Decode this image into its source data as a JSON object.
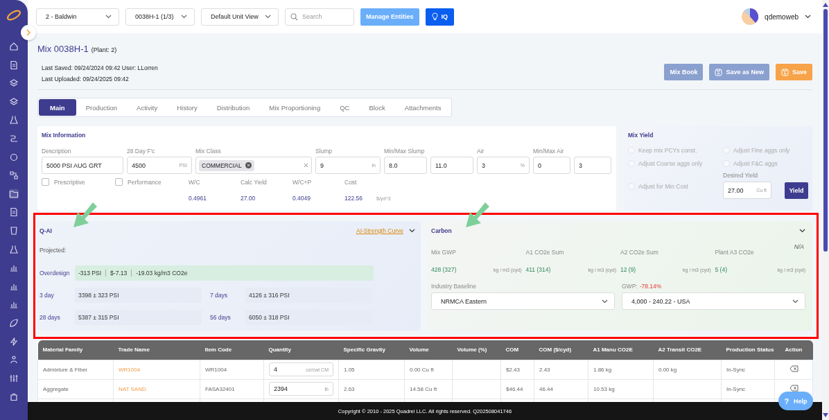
{
  "topbar": {
    "selects": [
      "2 - Baldwin",
      "0038H-1 (1/3)",
      "Default Unit View"
    ],
    "search": {
      "placeholder": "Search"
    },
    "manage_button": "Manage Entities",
    "iq_button": "IQ",
    "user": "qdemoweb"
  },
  "header": {
    "title": "Mix 0038H-1",
    "plant": "(Plant: 2)",
    "last_saved": "Last Saved: 09/24/2024 09:42 User: LLorren",
    "last_uploaded": "Last Uploaded: 09/24/2025 09:42",
    "buttons": [
      {
        "label": "Mix Book",
        "kind": "plain"
      },
      {
        "label": "Save as New",
        "kind": "secondary"
      },
      {
        "label": "Save",
        "kind": "primary"
      }
    ]
  },
  "tabs": [
    {
      "label": "Main",
      "selected": true
    },
    {
      "label": "Production",
      "selected": false
    },
    {
      "label": "Activity",
      "selected": false
    },
    {
      "label": "History",
      "selected": false
    },
    {
      "label": "Distribution",
      "selected": false
    },
    {
      "label": "Mix Proportioning",
      "selected": false
    },
    {
      "label": "QC",
      "selected": false
    },
    {
      "label": "Block",
      "selected": false
    },
    {
      "label": "Attachments",
      "selected": false
    }
  ],
  "mix_information": {
    "title": "Mix Information",
    "fields": [
      {
        "label": "Description",
        "kind": "text",
        "inputs": [
          {
            "value": "5000 PSI AUG GRT"
          }
        ]
      },
      {
        "label": "28 Day F'c",
        "kind": "text",
        "inputs": [
          {
            "value": "4500",
            "unit": "PSI"
          }
        ]
      },
      {
        "label": "Mix Class",
        "kind": "chips",
        "chips": [
          "COMMERCIAL"
        ]
      },
      {
        "label": "Slump",
        "kind": "text",
        "inputs": [
          {
            "value": "9",
            "unit": "in"
          }
        ]
      },
      {
        "label": "Min/Max Slump",
        "kind": "text",
        "inputs": [
          {
            "value": "8.0"
          },
          {
            "value": "11.0"
          }
        ]
      },
      {
        "label": "Air",
        "kind": "text",
        "inputs": [
          {
            "value": "3",
            "unit": "%"
          }
        ]
      },
      {
        "label": "Min/Max Air",
        "kind": "text",
        "inputs": [
          {
            "value": "0"
          },
          {
            "value": "3"
          }
        ]
      }
    ],
    "checkboxes": [
      {
        "label": "Prescriptive",
        "checked": false
      },
      {
        "label": "Performance",
        "checked": false
      }
    ],
    "stats": [
      {
        "label": "W/C",
        "value": "0.4961"
      },
      {
        "label": "Calc Yield",
        "value": "27.00"
      },
      {
        "label": "W/C+P",
        "value": "0.4049"
      },
      {
        "label": "Cost",
        "value": "122.56",
        "unit": "$/yd^3"
      }
    ]
  },
  "mix_yield": {
    "title": "Mix Yield",
    "options": [
      {
        "label": "Keep mix PCYs const.",
        "selected": false
      },
      {
        "label": "Adjust Fine aggs only",
        "selected": false
      },
      {
        "label": "Adjust Coarse aggs only",
        "selected": false
      },
      {
        "label": "Adjust F&C aggs",
        "selected": false
      },
      {
        "label": "Adjust for Min Cost",
        "selected": false
      }
    ],
    "desired_label": "Desired Yield",
    "desired_value": "27.00",
    "desired_unit": "Cu ft",
    "button": "Yield"
  },
  "q_ai": {
    "title": "Q-AI",
    "link": "AI-Strength Curve",
    "projected": "Projected:",
    "overdesign_label": "Overdesign",
    "overdesign": [
      "-313 PSI",
      "$-7.13",
      "-19.03 kg/m3 CO2e"
    ],
    "strengths": [
      {
        "label": "3 day",
        "value": "3398 ± 323 PSI"
      },
      {
        "label": "7 days",
        "value": "4126 ± 316 PSI"
      },
      {
        "label": "28 days",
        "value": "5387 ± 315 PSI"
      },
      {
        "label": "56 days",
        "value": "6050 ± 318 PSI"
      }
    ]
  },
  "carbon": {
    "title": "Carbon",
    "note": "N/A",
    "metrics": [
      {
        "label": "Mix GWP",
        "value": "428 (327)",
        "unit": "kg / m3 (cyd)"
      },
      {
        "label": "A1 CO2e Sum",
        "value": "411 (314)",
        "unit": "kg / m3 (cyd)"
      },
      {
        "label": "A2 CO2e Sum",
        "value": "12 (9)",
        "unit": "kg / m3 (cyd)"
      },
      {
        "label": "Plant A3 CO2e",
        "value": "5 (4)",
        "unit": "kg / m3 (cyd)"
      }
    ],
    "baseline_label": "Industry Baseline",
    "baseline": "NRMCA Eastern",
    "gwp_label": "GWP:",
    "gwp_value": "-78.14%",
    "gwp_select": "4,000 - 240.22 - USA"
  },
  "table": {
    "columns": [
      "Material Family",
      "Trade Name",
      "Item Code",
      "Quantity",
      "Specific Gravity",
      "Volume",
      "Volume (%)",
      "COM",
      "COM ($/cyd)",
      "A1 Manu CO2E",
      "A2 Transit CO2E",
      "Production Status",
      "Action"
    ],
    "rows": [
      {
        "family": "Admixture & Fiber",
        "trade_name": "WR1004",
        "item_code": "WR1004",
        "quantity": "4",
        "quantity_unit": "oz/cwt CM",
        "specific_gravity": "1.05",
        "volume": "0.00 Cu ft",
        "com": "$2.43",
        "com_cyd": "2.43",
        "a1": "1.86 kg",
        "a2": "0.00 kg",
        "status": "In-Sync"
      },
      {
        "family": "Aggregate",
        "trade_name": "NAT SAND",
        "item_code": "FASA32401",
        "quantity": "2394",
        "quantity_unit": "lb",
        "specific_gravity": "2.63",
        "volume": "14.58 Cu ft",
        "com": "$46.44",
        "com_cyd": "46.44",
        "a1": "10.53 kg",
        "status": "In-Sync"
      }
    ]
  },
  "footer": "Copyright © 2010 - 2025 Quadrel LLC. All rights reserved. Q202508041746",
  "help": {
    "icon": "?",
    "label": "Help"
  }
}
